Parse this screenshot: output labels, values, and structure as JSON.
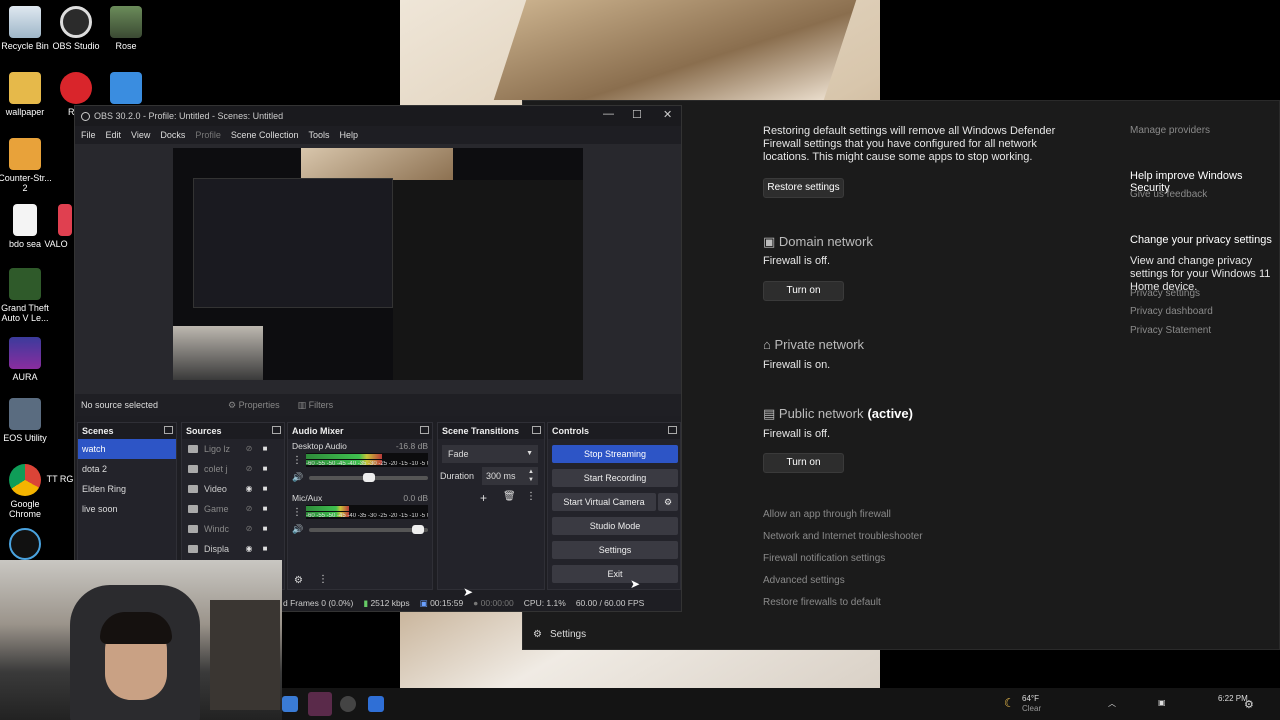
{
  "desktop": {
    "icons": [
      {
        "label": "Recycle Bin"
      },
      {
        "label": "OBS Studio"
      },
      {
        "label": "Rose"
      },
      {
        "label": "wallpaper"
      },
      {
        "label": "Riot"
      },
      {
        "label": "Counter-Str... 2"
      },
      {
        "label": "bdo sea"
      },
      {
        "label": "VALO"
      },
      {
        "label": "Grand Theft Auto V Le..."
      },
      {
        "label": "AURA"
      },
      {
        "label": "EOS Utility"
      },
      {
        "label": "Google Chrome"
      },
      {
        "label": "TT RG"
      }
    ]
  },
  "obs": {
    "title": "OBS 30.2.0 - Profile: Untitled - Scenes: Untitled",
    "menu": [
      "File",
      "Edit",
      "View",
      "Docks",
      "Profile",
      "Scene Collection",
      "Tools",
      "Help"
    ],
    "no_source": "No source selected",
    "properties": "Properties",
    "filters": "Filters",
    "scenes": {
      "title": "Scenes",
      "items": [
        "watch",
        "dota 2",
        "Elden Ring",
        "live soon"
      ]
    },
    "sources": {
      "title": "Sources",
      "items": [
        "Ligo lz",
        "colet j",
        "Video",
        "Game",
        "Windc",
        "Displa"
      ]
    },
    "audio_mixer": {
      "title": "Audio Mixer",
      "channels": [
        {
          "name": "Desktop Audio",
          "db": "-16.8 dB",
          "level": 0.62,
          "volume": 0.5
        },
        {
          "name": "Mic/Aux",
          "db": "0.0 dB",
          "level": 0.35,
          "volume": 0.92
        }
      ],
      "scale": "-60 -55 -50 -45 -40 -35 -30 -25 -20 -15 -10 -5 0"
    },
    "transitions": {
      "title": "Scene Transitions",
      "selected": "Fade",
      "duration_label": "Duration",
      "duration": "300 ms"
    },
    "controls": {
      "title": "Controls",
      "stop_streaming": "Stop Streaming",
      "start_recording": "Start Recording",
      "start_virtual_camera": "Start Virtual Camera",
      "studio_mode": "Studio Mode",
      "settings": "Settings",
      "exit": "Exit"
    },
    "status": {
      "frames": "d Frames 0 (0.0%)",
      "bitrate": "2512 kbps",
      "stream_time": "00:15:59",
      "rec_time": "00:00:00",
      "cpu": "CPU: 1.1%",
      "fps": "60.00 / 60.00 FPS"
    }
  },
  "winsec": {
    "restore_text": "Restoring default settings will remove all Windows Defender Firewall settings that you have configured for all network locations. This might cause some apps to stop working.",
    "restore_button": "Restore settings",
    "domain": {
      "title": "Domain network",
      "status": "Firewall is off.",
      "button": "Turn on"
    },
    "private": {
      "title": "Private network",
      "status": "Firewall is on."
    },
    "public": {
      "title": "Public network",
      "badge": "(active)",
      "status": "Firewall is off.",
      "button": "Turn on"
    },
    "links": [
      "Allow an app through firewall",
      "Network and Internet troubleshooter",
      "Firewall notification settings",
      "Advanced settings",
      "Restore firewalls to default"
    ],
    "side": {
      "manage_providers": "Manage providers",
      "help_title": "Help improve Windows Security",
      "feedback": "Give us feedback",
      "privacy_title": "Change your privacy settings",
      "privacy_text": "View and change privacy settings for your Windows 11 Home device.",
      "privacy_links": [
        "Privacy settings",
        "Privacy dashboard",
        "Privacy Statement"
      ]
    },
    "settings": "Settings"
  },
  "taskbar": {
    "weather_temp": "64°F",
    "weather_desc": "Clear",
    "time": "6:22 PM"
  }
}
